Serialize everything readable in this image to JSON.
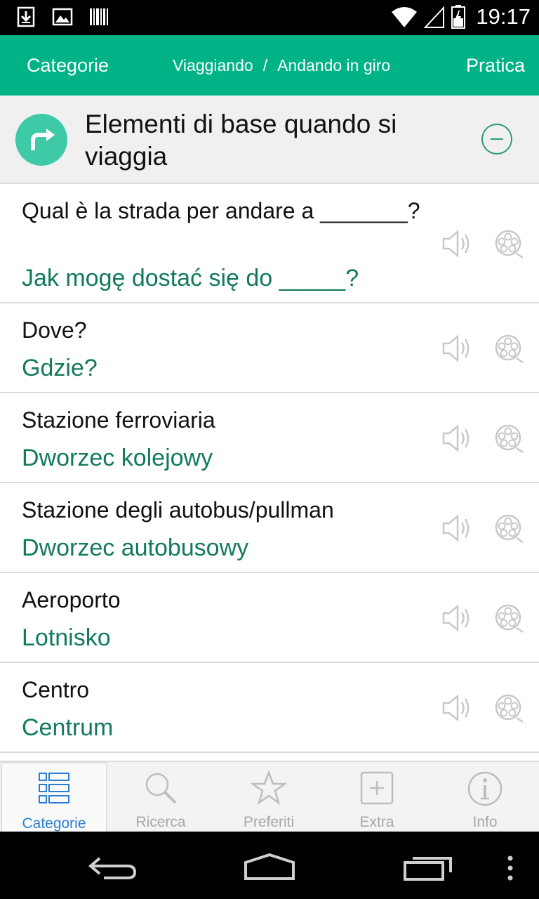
{
  "status_bar": {
    "time": "19:17",
    "left_icons": [
      "download-icon",
      "image-icon",
      "barcode-icon"
    ],
    "right_icons": [
      "wifi-icon",
      "signal-icon",
      "battery-icon"
    ]
  },
  "action_bar": {
    "left_label": "Categorie",
    "breadcrumb_1": "Viaggiando",
    "breadcrumb_sep": "/",
    "breadcrumb_2": "Andando in giro",
    "right_label": "Pratica"
  },
  "section": {
    "title": "Elementi di base quando si viaggia",
    "icon": "turn-right-arrow-icon",
    "collapse_icon": "minus-circle-icon"
  },
  "phrases": [
    {
      "italian": "Qual è la strada per andare a _______?",
      "polish": "Jak mogę dostać się do _____?"
    },
    {
      "italian": "Dove?",
      "polish": "Gdzie?"
    },
    {
      "italian": "Stazione ferroviaria",
      "polish": "Dworzec kolejowy"
    },
    {
      "italian": "Stazione degli autobus/pullman",
      "polish": "Dworzec autobusowy"
    },
    {
      "italian": "Aeroporto",
      "polish": "Lotnisko"
    },
    {
      "italian": "Centro",
      "polish": "Centrum"
    }
  ],
  "tabs": [
    {
      "label": "Categorie",
      "icon": "list-icon",
      "active": true
    },
    {
      "label": "Ricerca",
      "icon": "search-icon",
      "active": false
    },
    {
      "label": "Preferiti",
      "icon": "star-icon",
      "active": false
    },
    {
      "label": "Extra",
      "icon": "plus-box-icon",
      "active": false
    },
    {
      "label": "Info",
      "icon": "info-icon",
      "active": false
    }
  ],
  "colors": {
    "accent": "#00b386",
    "translation_text": "#137a5a",
    "active_tab": "#2a7fd0"
  }
}
